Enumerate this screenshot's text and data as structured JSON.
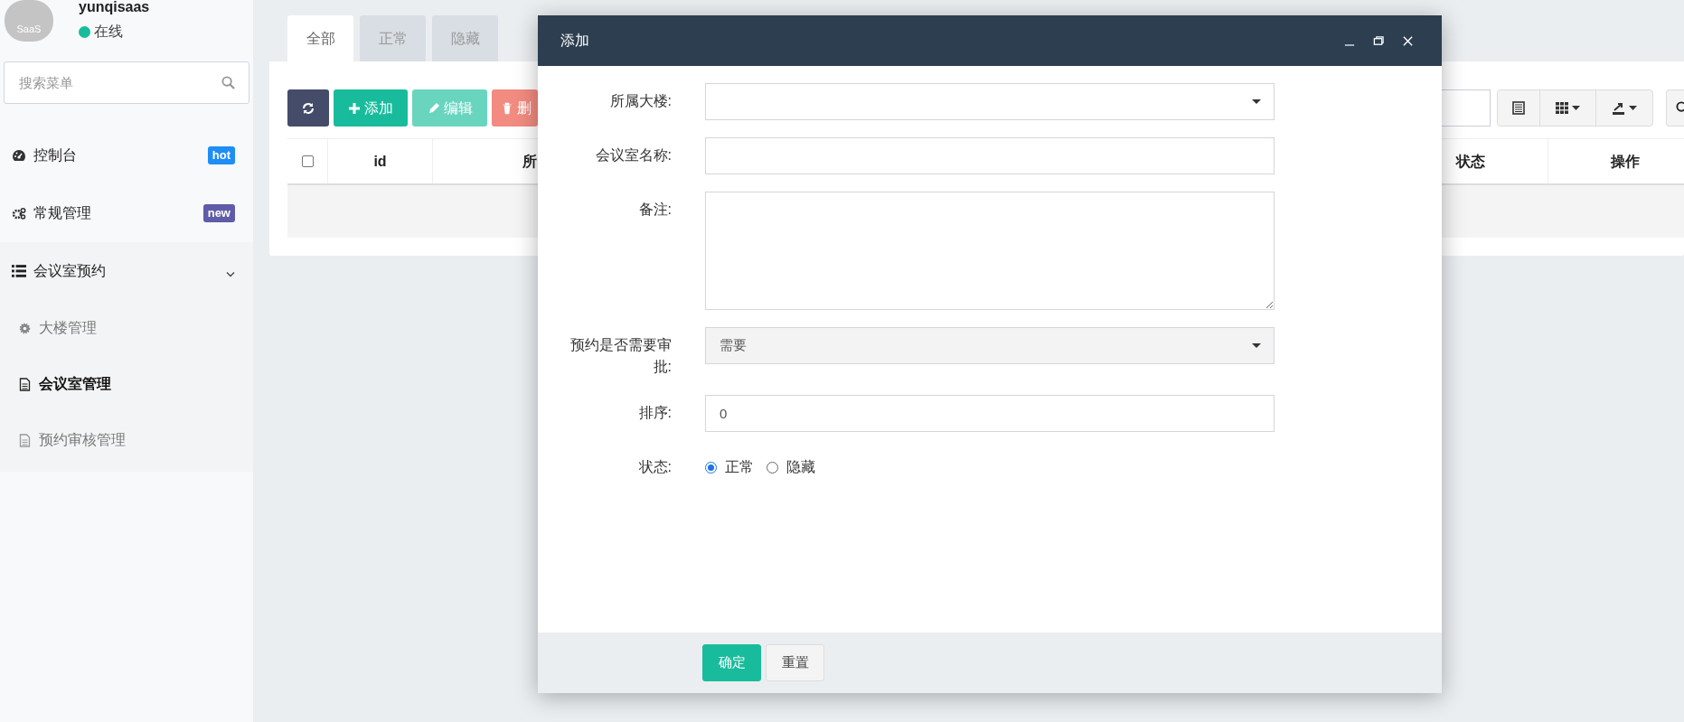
{
  "sidebar": {
    "logo_text": "SaaS",
    "user": {
      "name": "yunqisaas",
      "status": "在线"
    },
    "search": {
      "placeholder": "搜索菜单"
    },
    "menu": [
      {
        "kind": "dashboard",
        "label": "控制台",
        "badge": {
          "text": "hot",
          "color": "#1e8ef5"
        }
      },
      {
        "kind": "gears",
        "label": "常规管理",
        "badge": {
          "text": "new",
          "color": "#605ca8"
        }
      },
      {
        "kind": "list",
        "label": "会议室预约",
        "expanded": true,
        "children": [
          {
            "kind": "gear",
            "label": "大楼管理",
            "selected": false
          },
          {
            "kind": "file",
            "label": "会议室管理",
            "selected": true
          },
          {
            "kind": "file",
            "label": "预约审核管理",
            "selected": false
          }
        ]
      }
    ]
  },
  "main": {
    "tabs": [
      {
        "label": "全部",
        "selected": true
      },
      {
        "label": "正常",
        "selected": false
      },
      {
        "label": "隐藏",
        "selected": false
      }
    ],
    "toolbar": [
      {
        "kind": "refresh"
      },
      {
        "kind": "add",
        "label": "添加"
      },
      {
        "kind": "edit",
        "label": "编辑"
      },
      {
        "kind": "delete",
        "label": "删"
      }
    ],
    "table": {
      "select_all_checked": false,
      "columns": [
        "id",
        "所",
        "状态",
        "操作"
      ]
    }
  },
  "dialog": {
    "title": "添加",
    "fields": [
      {
        "kind": "select",
        "label": "所属大楼:"
      },
      {
        "kind": "text",
        "label": "会议室名称:"
      },
      {
        "kind": "textarea",
        "label": "备注:"
      },
      {
        "kind": "select",
        "label": "预约是否需要审批:",
        "value": "需要",
        "disabled": true
      },
      {
        "kind": "text",
        "label": "排序:",
        "value": "0"
      },
      {
        "kind": "radio",
        "label": "状态:",
        "options": [
          {
            "label": "正常",
            "selected": true
          },
          {
            "label": "隐藏",
            "selected": false
          }
        ]
      }
    ],
    "buttons": [
      {
        "kind": "primary",
        "label": "确定"
      },
      {
        "kind": "default",
        "label": "重置"
      }
    ]
  }
}
